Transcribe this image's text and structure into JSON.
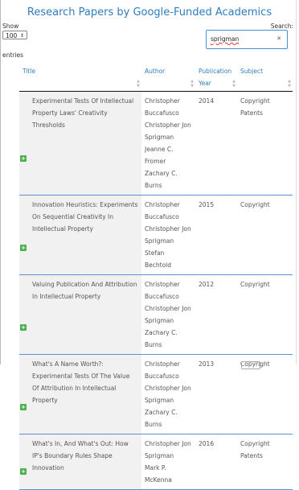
{
  "page_title": "Research Papers by Google-Funded Academics",
  "controls": {
    "show_label": "Show",
    "page_size": "100",
    "entries_label": "entries",
    "search_label": "Search:",
    "search_value": "sprigman",
    "clear_icon": "x-icon"
  },
  "table": {
    "headers": [
      "Title",
      "Author",
      "Publication Year",
      "Subject"
    ],
    "rows": [
      {
        "title": "Experimental Tests Of Intellectual Property Laws' Creativity Thresholds",
        "authors": [
          "Christopher Buccafusco",
          "Christopher Jon Sprigman",
          "Jeanne C. Fromer",
          "Zachary C. Burns"
        ],
        "year": "2014",
        "subjects": [
          "Copyright",
          "Patents"
        ]
      },
      {
        "title": "Innovation Heuristics: Experiments On Sequential Creativity In Intellectual Property",
        "authors": [
          "Christopher Buccafusco",
          "Christopher Jon Sprigman",
          "Stefan Bechtold"
        ],
        "year": "2015",
        "subjects": [
          "Copyright"
        ]
      },
      {
        "title": "Valuing Publication And Attribution In Intellectual Property",
        "authors": [
          "Christopher Buccafusco",
          "Christopher Jon Sprigman",
          "Zachary C. Burns"
        ],
        "year": "2012",
        "subjects": [
          "Copyright"
        ]
      },
      {
        "title": "What's A Name Worth?: Experimental Tests Of The Value Of Attribution In Intellectual Property",
        "authors": [
          "Christopher Buccafusco",
          "Christopher Jon Sprigman",
          "Zachary C. Burns"
        ],
        "year": "2013",
        "subjects": [
          "Copyright"
        ]
      },
      {
        "title": "What's In, And What's Out: How IP's Boundary Rules Shape Innovation",
        "authors": [
          "Christopher Jon Sprigman",
          "Mark P. McKenna"
        ],
        "year": "2016",
        "subjects": [
          "Copyright",
          "Patents"
        ]
      }
    ]
  },
  "colors": {
    "accent": "#2f7cc0",
    "expand": "#4cae4c",
    "row_divider": "#5a93d4"
  }
}
